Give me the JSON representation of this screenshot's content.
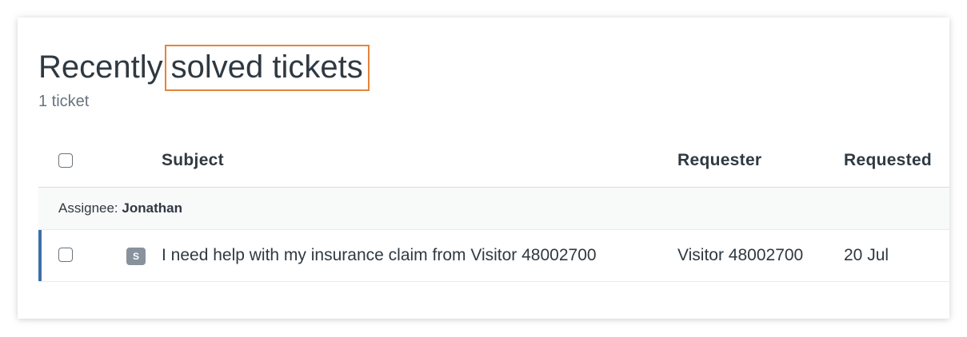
{
  "page": {
    "title_prefix": "Recently",
    "title_highlight": "solved tickets",
    "ticket_count": "1 ticket"
  },
  "table": {
    "columns": {
      "subject": "Subject",
      "requester": "Requester",
      "requested": "Requested"
    },
    "group": {
      "label": "Assignee:",
      "name": "Jonathan"
    },
    "rows": [
      {
        "status": "S",
        "subject": "I need help with my insurance claim from Visitor 48002700",
        "requester": "Visitor 48002700",
        "requested": "20 Jul"
      }
    ]
  },
  "colors": {
    "highlight_border": "#e6843a",
    "row_accent": "#3d6fa8",
    "status_badge": "#87929d"
  }
}
